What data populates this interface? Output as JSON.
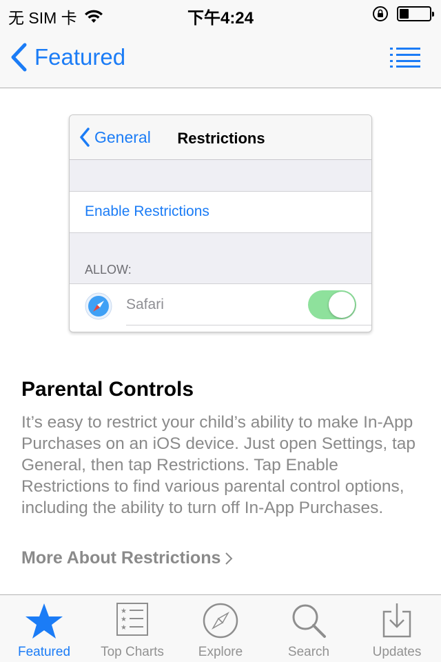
{
  "status_bar": {
    "carrier": "无 SIM 卡",
    "time": "下午4:24",
    "battery_level": 0.3
  },
  "nav": {
    "back_label": "Featured",
    "menu_icon": "list-icon"
  },
  "hero": {
    "back_label": "General",
    "title": "Restrictions",
    "enable_label": "Enable Restrictions",
    "section_header": "ALLOW:",
    "row_label": "Safari",
    "toggle_on": true
  },
  "article": {
    "title": "Parental Controls",
    "body": "It’s easy to restrict your child’s ability to make In-App Purchases on an iOS device. Just open Settings, tap General, then tap Restrictions. Tap Enable Restrictions to find various parental control options, including the ability to turn off In-App Purchases.",
    "more_label": "More About Restrictions"
  },
  "tabs": [
    {
      "label": "Featured",
      "icon": "star-icon",
      "active": true
    },
    {
      "label": "Top Charts",
      "icon": "list-icon",
      "active": false
    },
    {
      "label": "Explore",
      "icon": "compass-icon",
      "active": false
    },
    {
      "label": "Search",
      "icon": "search-icon",
      "active": false
    },
    {
      "label": "Updates",
      "icon": "download-icon",
      "active": false
    }
  ],
  "colors": {
    "accent": "#1b7cf6",
    "toggle_on": "#8ee19c",
    "body_text": "#8a8a8a"
  }
}
